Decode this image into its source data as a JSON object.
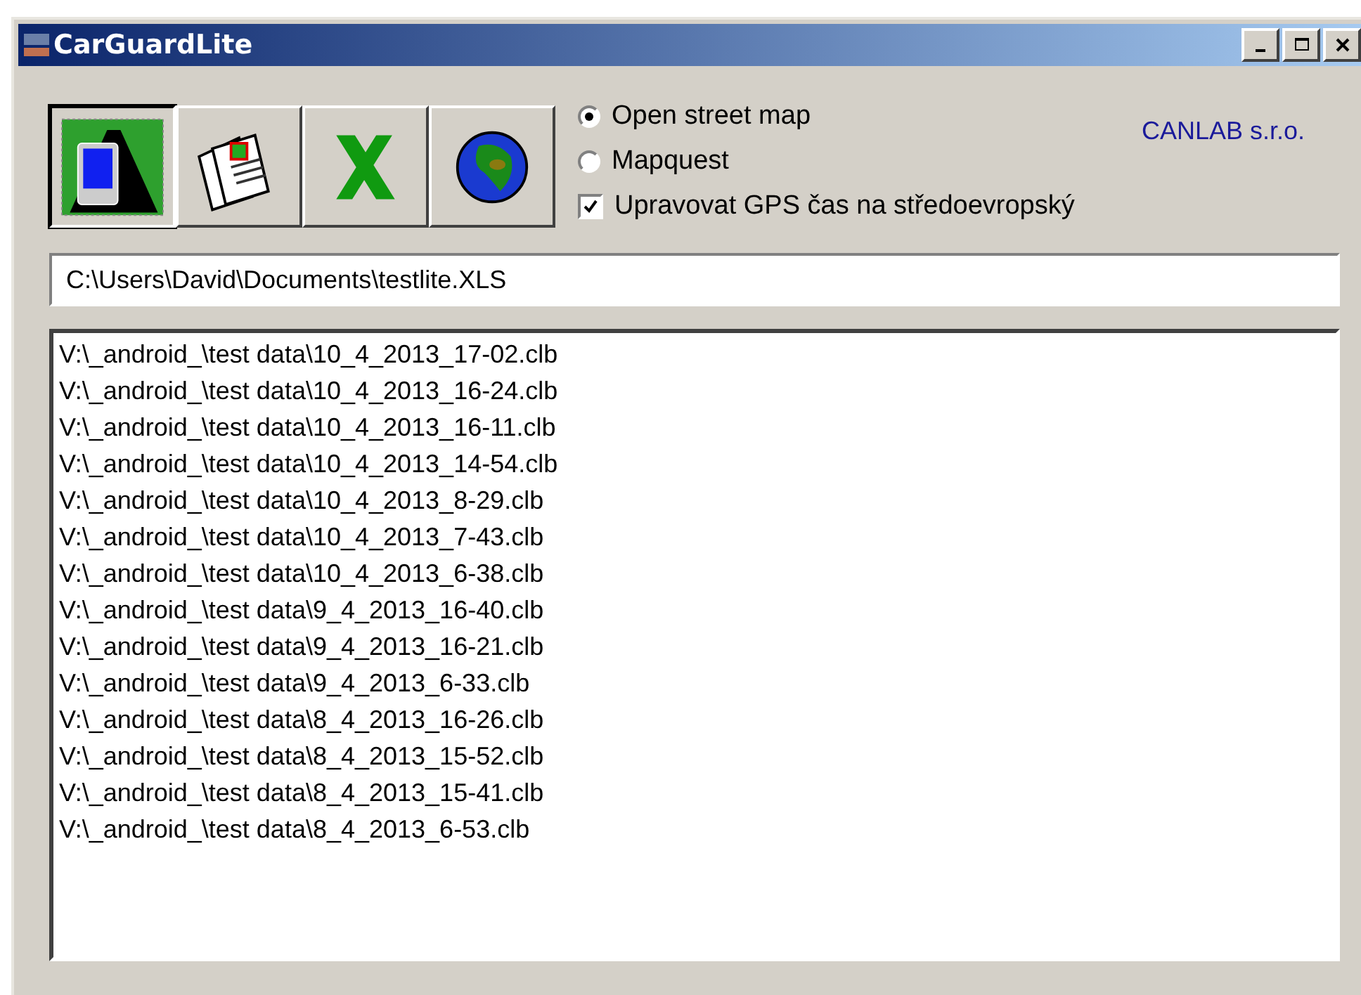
{
  "window": {
    "title": "CarGuardLite"
  },
  "toolbar": [
    {
      "kind": "device",
      "selected": true
    },
    {
      "kind": "documents",
      "selected": false
    },
    {
      "kind": "excel",
      "selected": false
    },
    {
      "kind": "globe",
      "selected": false
    }
  ],
  "map_options": [
    {
      "label": "Open street map",
      "selected": true
    },
    {
      "label": "Mapquest",
      "selected": false
    }
  ],
  "gps_checkbox": {
    "label": "Upravovat GPS čas na středoevropský",
    "checked": true
  },
  "company": "CANLAB s.r.o.",
  "path_field": {
    "value": "C:\\Users\\David\\Documents\\testlite.XLS"
  },
  "files": [
    "V:\\_android_\\test data\\10_4_2013_17-02.clb",
    "V:\\_android_\\test data\\10_4_2013_16-24.clb",
    "V:\\_android_\\test data\\10_4_2013_16-11.clb",
    "V:\\_android_\\test data\\10_4_2013_14-54.clb",
    "V:\\_android_\\test data\\10_4_2013_8-29.clb",
    "V:\\_android_\\test data\\10_4_2013_7-43.clb",
    "V:\\_android_\\test data\\10_4_2013_6-38.clb",
    "V:\\_android_\\test data\\9_4_2013_16-40.clb",
    "V:\\_android_\\test data\\9_4_2013_16-21.clb",
    "V:\\_android_\\test data\\9_4_2013_6-33.clb",
    "V:\\_android_\\test data\\8_4_2013_16-26.clb",
    "V:\\_android_\\test data\\8_4_2013_15-52.clb",
    "V:\\_android_\\test data\\8_4_2013_15-41.clb",
    "V:\\_android_\\test data\\8_4_2013_6-53.clb"
  ]
}
